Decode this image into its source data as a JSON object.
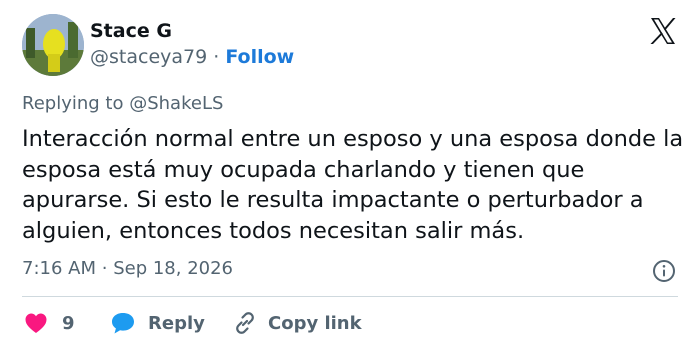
{
  "user": {
    "display_name": "Stace G",
    "handle": "@staceya79",
    "separator": "·",
    "follow_label": "Follow"
  },
  "replying_to": {
    "prefix": "Replying to",
    "mention": "@ShakeLS"
  },
  "tweet": {
    "text": "Interacción normal entre un esposo y una esposa donde la esposa está muy ocupada charlando y tienen que apurarse. Si esto le resulta impactante o perturbador a alguien, entonces todos necesitan salir más.",
    "time": "7:16 AM",
    "separator": "·",
    "date": "Sep 18, 2026"
  },
  "actions": {
    "like_count": "9",
    "reply_label": "Reply",
    "copy_link_label": "Copy link"
  },
  "icons": {
    "logo": "x-logo-icon",
    "info": "info-icon",
    "like": "heart-icon",
    "reply": "speech-bubble-icon",
    "copy": "link-icon"
  },
  "colors": {
    "text": "#0f1419",
    "secondary": "#536471",
    "link": "#1d7ad9",
    "heart": "#f91880",
    "reply_bubble": "#1d9bf0",
    "divider": "#cfd9de"
  }
}
